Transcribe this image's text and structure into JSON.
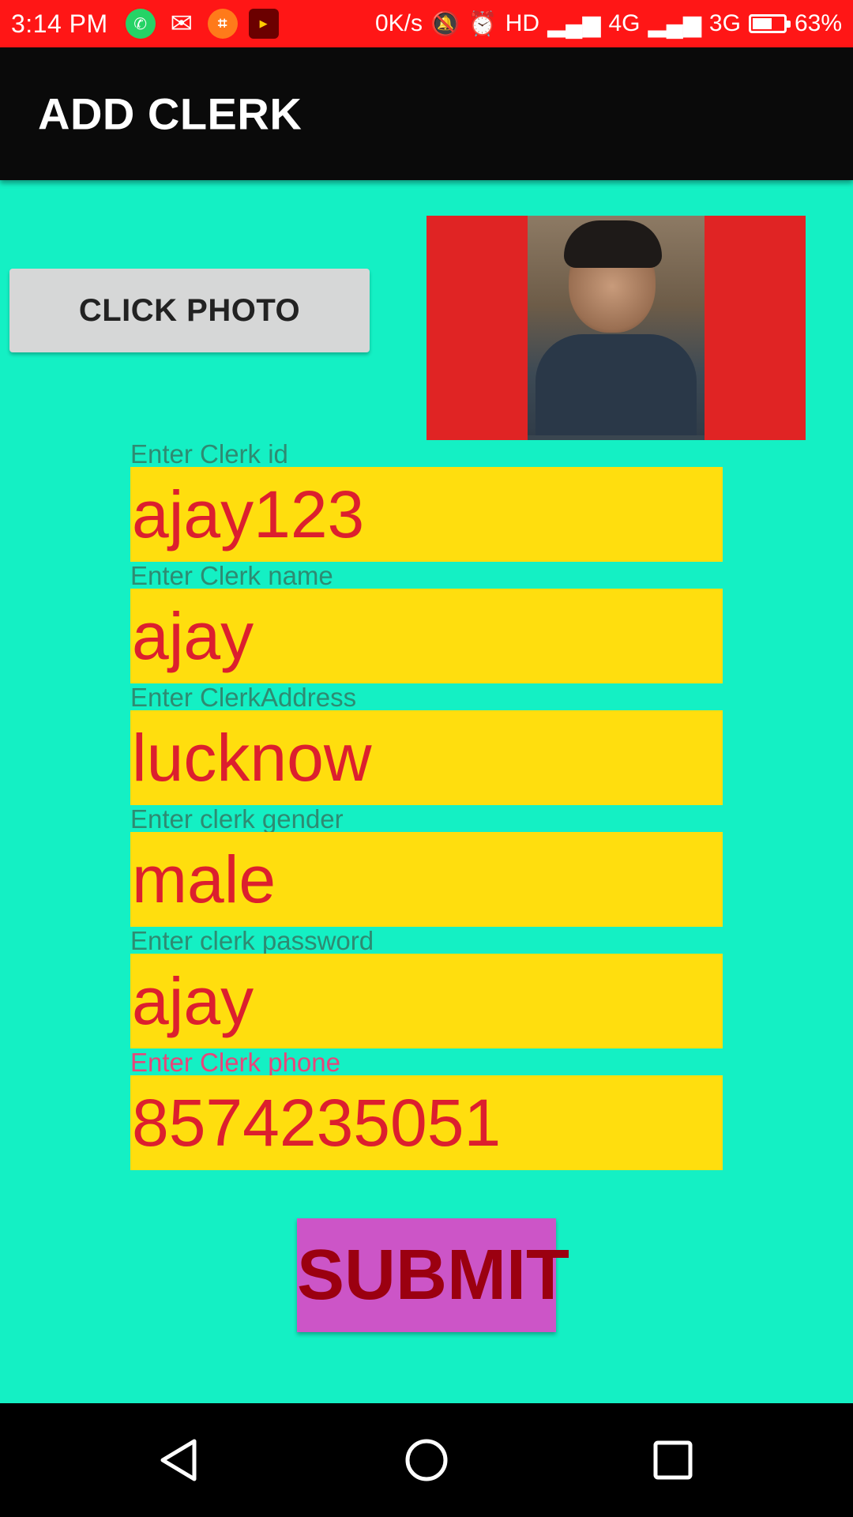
{
  "status_bar": {
    "time": "3:14 PM",
    "speed": "0K/s",
    "network_hd": "HD",
    "network_4g": "4G",
    "network_3g": "3G",
    "battery": "63%",
    "battery_level": 0.63,
    "icons": [
      "whatsapp-icon",
      "gmail-icon",
      "crop-icon",
      "tube-icon",
      "mute-icon",
      "alarm-icon",
      "signal-icon",
      "battery-icon"
    ]
  },
  "app_bar": {
    "title": "ADD CLERK"
  },
  "photo": {
    "button_label": "CLICK PHOTO",
    "frame_color": "#E02424"
  },
  "form": {
    "fields": [
      {
        "label": "Enter Clerk id",
        "value": "ajay123"
      },
      {
        "label": "Enter Clerk name",
        "value": "ajay"
      },
      {
        "label": "Enter ClerkAddress",
        "value": "lucknow"
      },
      {
        "label": "Enter clerk gender",
        "value": "male"
      },
      {
        "label": "Enter clerk password",
        "value": "ajay"
      },
      {
        "label": "Enter Clerk phone",
        "value": "8574235051"
      }
    ],
    "submit_label": "SUBMIT"
  },
  "colors": {
    "background": "#14F0C4",
    "status_bar": "#FF1616",
    "app_bar": "#0A0A0A",
    "input_bg": "#FFDE0E",
    "input_text": "#DC1F2E",
    "label": "#2E8B72",
    "label_focused": "#E8457A",
    "submit_bg": "#CC55C7",
    "submit_text": "#9B0010"
  }
}
